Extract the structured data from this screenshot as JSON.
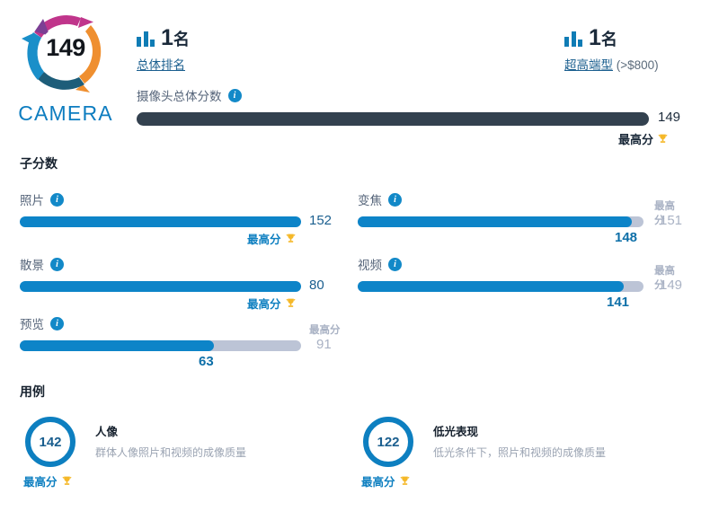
{
  "logo": {
    "score": "149",
    "word": "CAMERA"
  },
  "ranks": [
    {
      "value": "1",
      "unit": "名",
      "label": "总体排名",
      "suffix": "",
      "icon": "bar-chart-icon"
    },
    {
      "value": "1",
      "unit": "名",
      "label": "超高端型",
      "suffix": " (>$800)",
      "icon": "bar-chart-icon"
    }
  ],
  "overall": {
    "label": "摄像头总体分数",
    "info_icon": "info-icon",
    "value": "149",
    "best_label": "最高分",
    "trophy_icon": "trophy-icon"
  },
  "sections": {
    "subscores_title": "子分数",
    "usecases_title": "用例"
  },
  "subscores": [
    {
      "label": "照片",
      "value": "152",
      "max": null,
      "max_label": null,
      "best_label": "最高分",
      "is_best": true,
      "fill_pct": 100
    },
    {
      "label": "变焦",
      "value": "148",
      "max": "151",
      "max_label": "最高分",
      "best_label": null,
      "is_best": false,
      "fill_pct": 96
    },
    {
      "label": "散景",
      "value": "80",
      "max": null,
      "max_label": null,
      "best_label": "最高分",
      "is_best": true,
      "fill_pct": 100
    },
    {
      "label": "视频",
      "value": "141",
      "max": "149",
      "max_label": "最高分",
      "best_label": null,
      "is_best": false,
      "fill_pct": 93
    },
    {
      "label": "预览",
      "value": "63",
      "max": "91",
      "max_label": "最高分",
      "best_label": null,
      "is_best": false,
      "fill_pct": 69
    }
  ],
  "usecases": [
    {
      "score": "142",
      "title": "人像",
      "desc": "群体人像照片和视频的成像质量",
      "best_label": "最高分"
    },
    {
      "score": "122",
      "title": "低光表现",
      "desc": "低光条件下，照片和视频的成像质量",
      "best_label": "最高分"
    }
  ],
  "colors": {
    "blue": "#0d84c8",
    "dark_bar": "#33414f",
    "gray_track": "#bcc4d6",
    "gold": "#f5b828"
  }
}
